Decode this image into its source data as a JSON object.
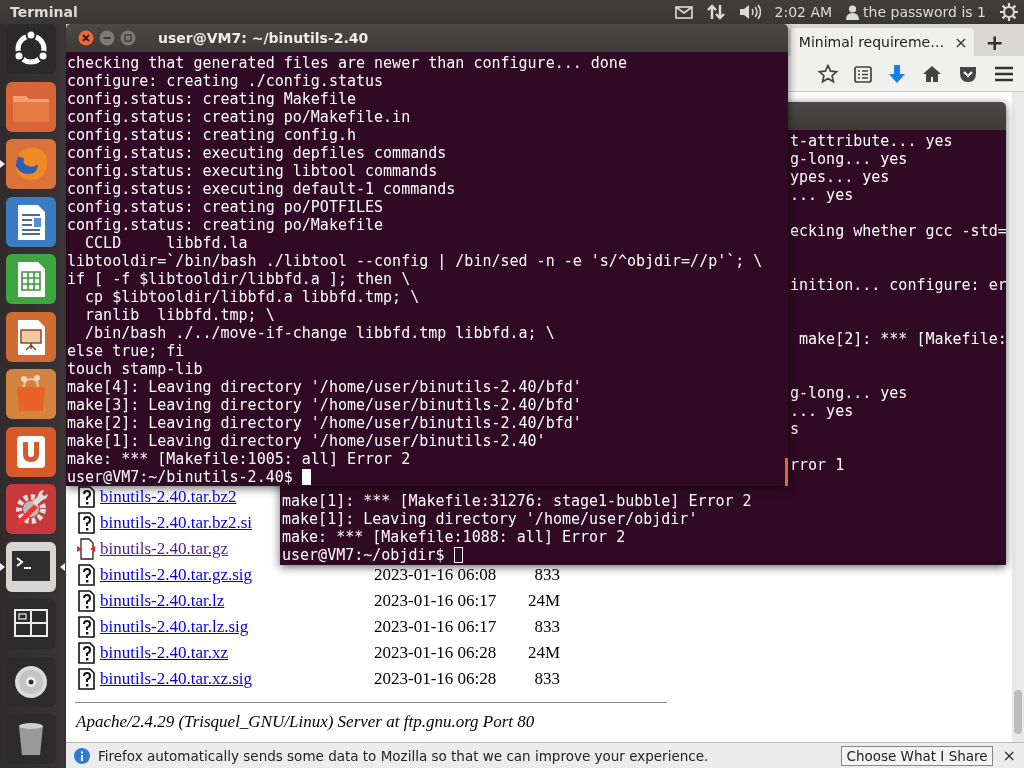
{
  "top_panel": {
    "app_title": "Terminal",
    "clock": "2:02 AM",
    "user": "the password is 1"
  },
  "launcher": [
    {
      "kind": "dash",
      "running": false,
      "focused": false
    },
    {
      "kind": "files",
      "running": false,
      "focused": false
    },
    {
      "kind": "browser",
      "running": true,
      "focused": false
    },
    {
      "kind": "document",
      "running": false,
      "focused": false
    },
    {
      "kind": "spreadsheet",
      "running": false,
      "focused": false
    },
    {
      "kind": "presentation",
      "running": false,
      "focused": false
    },
    {
      "kind": "store",
      "running": false,
      "focused": false
    },
    {
      "kind": "cloud",
      "running": false,
      "focused": false
    },
    {
      "kind": "settings",
      "running": false,
      "focused": false
    },
    {
      "kind": "terminal",
      "running": true,
      "focused": true
    },
    {
      "kind": "workspaces",
      "running": false,
      "focused": false
    },
    {
      "kind": "disc",
      "running": false,
      "focused": false
    },
    {
      "kind": "trash",
      "running": false,
      "focused": false
    }
  ],
  "browser": {
    "tabs": [
      {
        "label": "Minimal requireme…",
        "close": "×",
        "selected": true
      }
    ],
    "new_tab": "+",
    "listing": [
      {
        "name": "binutils-2.40.tar.bz2",
        "kind": "unknown",
        "visited": false
      },
      {
        "name": "binutils-2.40.tar.bz2.si",
        "kind": "unknown",
        "visited": false
      },
      {
        "name": "binutils-2.40.tar.gz",
        "kind": "compressed",
        "visited": true
      },
      {
        "name": "binutils-2.40.tar.gz.sig",
        "kind": "unknown",
        "visited": false,
        "date": "2023-01-16 06:08",
        "size": "833"
      },
      {
        "name": "binutils-2.40.tar.lz",
        "kind": "unknown",
        "visited": false,
        "date": "2023-01-16 06:17",
        "size": "24M"
      },
      {
        "name": "binutils-2.40.tar.lz.sig",
        "kind": "unknown",
        "visited": false,
        "date": "2023-01-16 06:17",
        "size": "833"
      },
      {
        "name": "binutils-2.40.tar.xz",
        "kind": "unknown",
        "visited": false,
        "date": "2023-01-16 06:28",
        "size": "24M"
      },
      {
        "name": "binutils-2.40.tar.xz.sig",
        "kind": "unknown",
        "visited": false,
        "date": "2023-01-16 06:28",
        "size": "833"
      }
    ],
    "footer": "Apache/2.4.29 (Trisquel_GNU/Linux) Server at ftp.gnu.org Port 80",
    "notification": {
      "message": "Firefox automatically sends some data to Mozilla so that we can improve your experience.",
      "button": "Choose What I Share",
      "close": "×"
    }
  },
  "background_terminal": {
    "focused": false,
    "right_lines": [
      {
        "kind": "output",
        "text": "t-attribute... yes"
      },
      {
        "kind": "output",
        "text": "g-long... yes"
      },
      {
        "kind": "output",
        "text": "ypes... yes"
      },
      {
        "kind": "output",
        "text": "... yes"
      },
      {
        "kind": "blank"
      },
      {
        "kind": "output",
        "text": "ecking whether gcc -std="
      },
      {
        "kind": "blank"
      },
      {
        "kind": "blank"
      },
      {
        "kind": "output",
        "text": "inition... configure: er"
      },
      {
        "kind": "blank"
      },
      {
        "kind": "blank"
      },
      {
        "kind": "output",
        "text": " make[2]: *** [Makefile:"
      },
      {
        "kind": "blank"
      },
      {
        "kind": "blank"
      },
      {
        "kind": "output",
        "text": "g-long... yes"
      },
      {
        "kind": "output",
        "text": "... yes"
      },
      {
        "kind": "output",
        "text": "s"
      },
      {
        "kind": "blank"
      },
      {
        "kind": "output",
        "text": "rror 1"
      }
    ],
    "bottom_lines": [
      "make[1]: *** [Makefile:31276: stage1-bubble] Error 2",
      "make[1]: Leaving directory '/home/user/objdir'",
      "make: *** [Makefile:1088: all] Error 2"
    ],
    "prompt": "user@VM7:~/objdir$"
  },
  "terminal": {
    "title": "user@VM7: ~/binutils-2.40",
    "focused": true,
    "lines": [
      "checking that generated files are newer than configure... done",
      "configure: creating ./config.status",
      "config.status: creating Makefile",
      "config.status: creating po/Makefile.in",
      "config.status: creating config.h",
      "config.status: executing depfiles commands",
      "config.status: executing libtool commands",
      "config.status: executing default-1 commands",
      "config.status: creating po/POTFILES",
      "config.status: creating po/Makefile",
      "  CCLD     libbfd.la",
      "libtooldir=`/bin/bash ./libtool --config | /bin/sed -n -e 's/^objdir=//p'`; \\",
      "if [ -f $libtooldir/libbfd.a ]; then \\",
      "  cp $libtooldir/libbfd.a libbfd.tmp; \\",
      "  ranlib  libbfd.tmp; \\",
      "  /bin/bash ./../move-if-change libbfd.tmp libbfd.a; \\",
      "else true; fi",
      "touch stamp-lib",
      "make[4]: Leaving directory '/home/user/binutils-2.40/bfd'",
      "make[3]: Leaving directory '/home/user/binutils-2.40/bfd'",
      "make[2]: Leaving directory '/home/user/binutils-2.40/bfd'",
      "make[1]: Leaving directory '/home/user/binutils-2.40'",
      "make: *** [Makefile:1005: all] Error 2"
    ],
    "prompt": "user@VM7:~/binutils-2.40$"
  }
}
